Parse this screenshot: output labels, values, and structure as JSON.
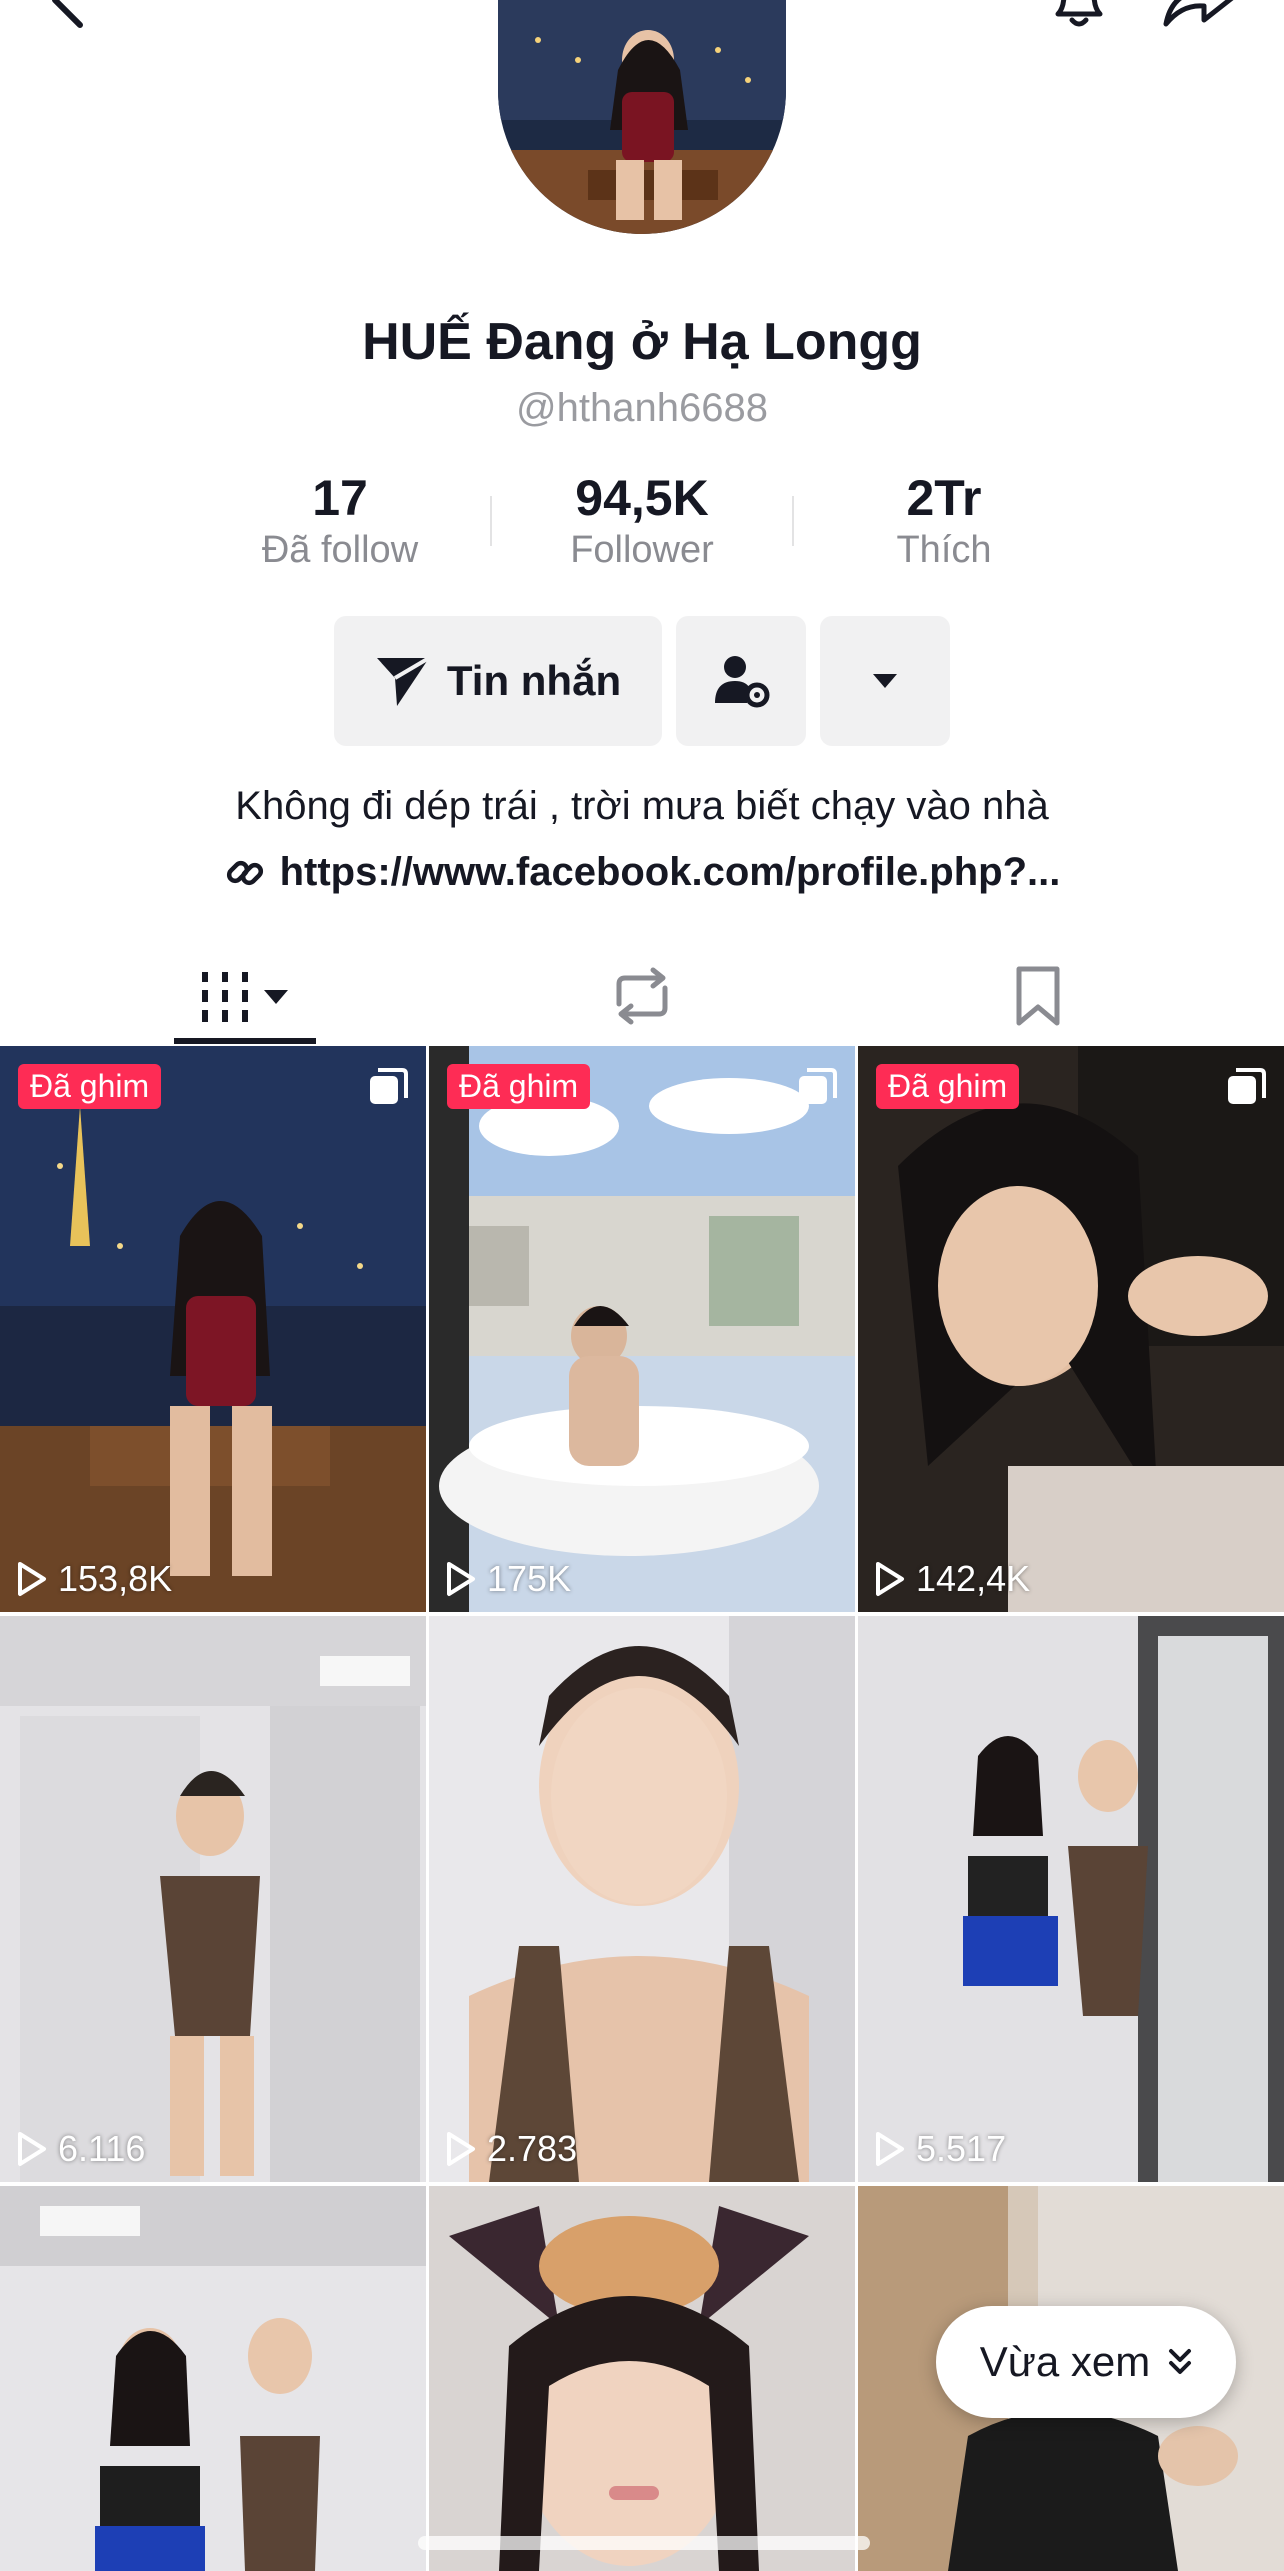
{
  "profile": {
    "display_name": "HUẾ Đang ở Hạ Longg",
    "username": "@hthanh6688",
    "bio": "Không đi dép trái , trời mưa biết chạy vào nhà",
    "link": "https://www.facebook.com/profile.php?..."
  },
  "stats": [
    {
      "value": "17",
      "label": "Đã follow"
    },
    {
      "value": "94,5K",
      "label": "Follower"
    },
    {
      "value": "2Tr",
      "label": "Thích"
    }
  ],
  "actions": {
    "message_label": "Tin nhắn"
  },
  "icons": {
    "back": "back-arrow-icon",
    "bell": "bell-icon",
    "share": "share-icon",
    "send": "send-icon",
    "user_settings": "user-gear-icon",
    "dropdown": "caret-down-icon",
    "link": "link-icon",
    "grid": "grid-icon",
    "repost": "repost-icon",
    "bookmark": "bookmark-icon",
    "play": "play-icon",
    "multi": "multi-photo-icon",
    "double_chevron": "double-chevron-down-icon"
  },
  "colors": {
    "pin_badge": "#fe2c55",
    "text_primary": "#161823",
    "text_secondary": "#8a8b91",
    "button_bg": "#f1f1f2"
  },
  "videos": [
    {
      "views": "153,8K",
      "pinned_label": "Đã ghim"
    },
    {
      "views": "175K",
      "pinned_label": "Đã ghim"
    },
    {
      "views": "142,4K",
      "pinned_label": "Đã ghim"
    },
    {
      "views": "6.116"
    },
    {
      "views": "2.783"
    },
    {
      "views": "5.517"
    },
    {
      "views": ""
    },
    {
      "views": ""
    },
    {
      "views": ""
    }
  ],
  "recent_pill": {
    "label": "Vừa xem"
  }
}
